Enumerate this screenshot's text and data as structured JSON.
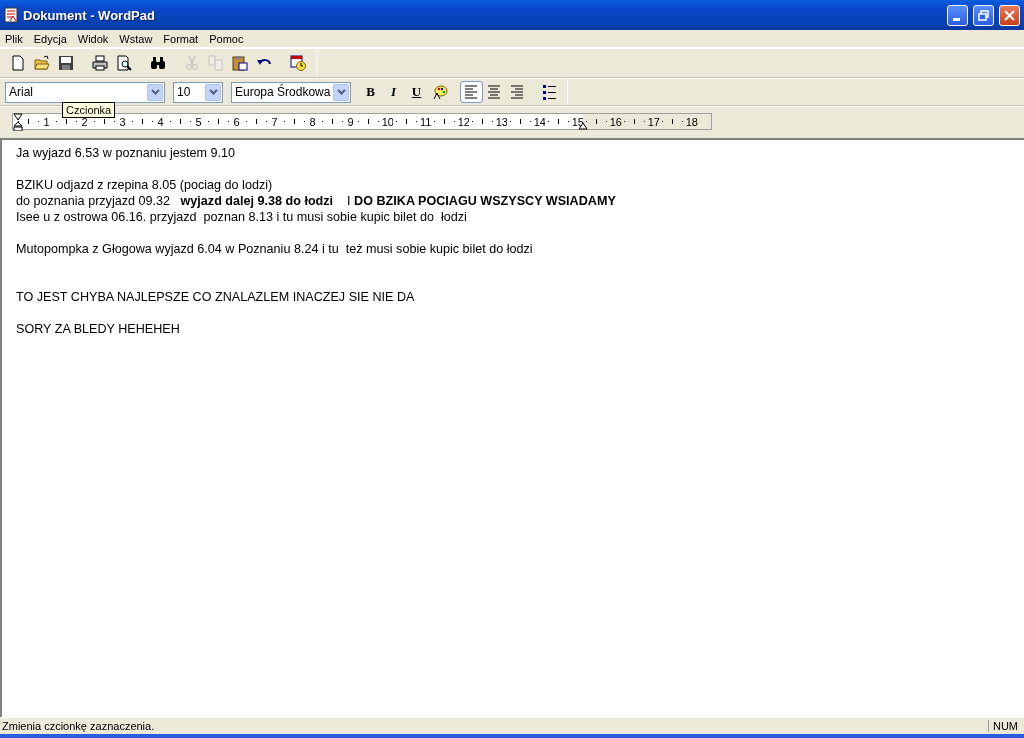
{
  "window": {
    "title": "Dokument - WordPad"
  },
  "menu": [
    "Plik",
    "Edycja",
    "Widok",
    "Wstaw",
    "Format",
    "Pomoc"
  ],
  "toolbar": [
    {
      "kind": "new",
      "disabled": false
    },
    {
      "kind": "open",
      "disabled": false
    },
    {
      "kind": "save",
      "disabled": false
    },
    {
      "kind": "sep"
    },
    {
      "kind": "print",
      "disabled": false
    },
    {
      "kind": "preview",
      "disabled": false
    },
    {
      "kind": "sep"
    },
    {
      "kind": "find",
      "disabled": false
    },
    {
      "kind": "sep"
    },
    {
      "kind": "cut",
      "disabled": true
    },
    {
      "kind": "copy",
      "disabled": true
    },
    {
      "kind": "paste",
      "disabled": false
    },
    {
      "kind": "undo",
      "disabled": false
    },
    {
      "kind": "sep"
    },
    {
      "kind": "datetime",
      "disabled": false
    }
  ],
  "format_bar": {
    "font": "Arial",
    "size": "10",
    "script": "Europa Środkowa",
    "buttons": [
      {
        "kind": "bold",
        "label": "B",
        "selected": false
      },
      {
        "kind": "italic",
        "label": "I",
        "selected": false
      },
      {
        "kind": "underline",
        "label": "U",
        "selected": false
      },
      {
        "kind": "color",
        "selected": false
      },
      {
        "kind": "sep"
      },
      {
        "kind": "align-left",
        "selected": true
      },
      {
        "kind": "align-center",
        "selected": false
      },
      {
        "kind": "align-right",
        "selected": false
      },
      {
        "kind": "sep"
      },
      {
        "kind": "bullets",
        "selected": false
      }
    ]
  },
  "tooltip": "Czcionka",
  "ruler": {
    "labels": [
      {
        "text": "1",
        "margin": false
      },
      {
        "text": "2",
        "margin": false
      },
      {
        "text": "3",
        "margin": false
      },
      {
        "text": "4",
        "margin": false
      },
      {
        "text": "5",
        "margin": false
      },
      {
        "text": "6",
        "margin": false
      },
      {
        "text": "7",
        "margin": false
      },
      {
        "text": "8",
        "margin": false
      },
      {
        "text": "9",
        "margin": false
      },
      {
        "text": "10",
        "margin": false
      },
      {
        "text": "11",
        "margin": false
      },
      {
        "text": "12",
        "margin": false
      },
      {
        "text": "13",
        "margin": false
      },
      {
        "text": "14",
        "margin": false
      },
      {
        "text": "15",
        "margin": true
      },
      {
        "text": "16",
        "margin": false
      },
      {
        "text": "17",
        "margin": false
      },
      {
        "text": "18",
        "margin": false
      }
    ]
  },
  "document": {
    "lines": [
      {
        "kind": "text",
        "text": "Ja wyjazd 6.53 w poznaniu jestem 9.10"
      },
      {
        "kind": "blank"
      },
      {
        "kind": "text",
        "text": "BZIKU odjazd z rzepina 8.05 (pociag do lodzi)"
      },
      {
        "kind": "text",
        "text": "do poznania przyjazd 09.32   **wyjazd dalej 9.38 do łodzi**    I **DO BZIKA POCIAGU WSZYSCY WSIADAMY**"
      },
      {
        "kind": "text",
        "text": "Isee u z ostrowa 06.16. przyjazd  poznan 8.13 i tu musi sobie kupic bilet do  łodzi"
      },
      {
        "kind": "blank"
      },
      {
        "kind": "text",
        "text": "Mutopompka z Głogowa wyjazd 6.04 w Poznaniu 8.24 i tu  też musi sobie kupic bilet do łodzi"
      },
      {
        "kind": "blank"
      },
      {
        "kind": "blank"
      },
      {
        "kind": "text",
        "text": "TO JEST CHYBA NAJLEPSZE CO ZNALAZLEM INACZEJ SIE NIE DA"
      },
      {
        "kind": "blank"
      },
      {
        "kind": "text",
        "text": "SORY ZA BLEDY HEHEHEH"
      }
    ]
  },
  "status_bar": {
    "message": "Zmienia czcionkę zaznaczenia.",
    "num": "NUM"
  }
}
